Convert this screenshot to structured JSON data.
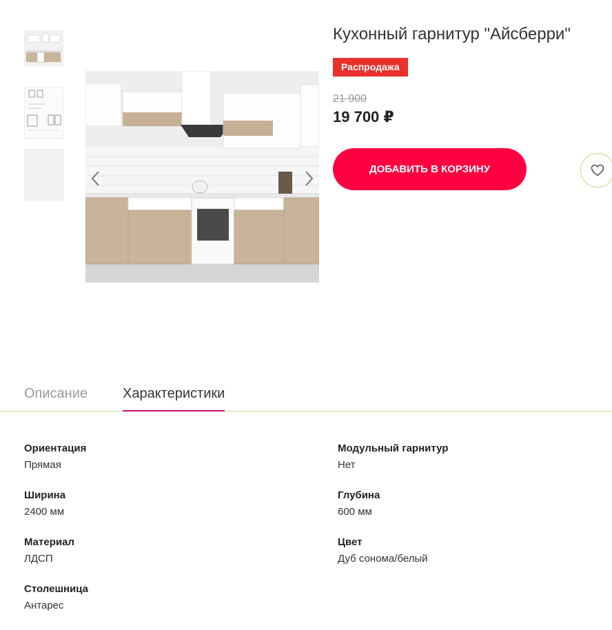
{
  "product": {
    "title": "Кухонный гарнитур \"Айсберри\"",
    "badge": "Распродажа",
    "old_price": "21 900",
    "price": "19 700 ₽",
    "cart_button": "ДОБАВИТЬ В КОРЗИНУ"
  },
  "gallery": {
    "thumbnails": [
      "kitchen-photo",
      "scheme-drawing",
      "texture-sample"
    ],
    "arrows": [
      "chevron-left-icon",
      "chevron-right-icon"
    ]
  },
  "icons": {
    "favorite": "heart-icon"
  },
  "tabs": {
    "description": "Описание",
    "specs": "Характеристики",
    "active": "Характеристики"
  },
  "specs": [
    {
      "key": "Ориентация",
      "value": "Прямая"
    },
    {
      "key": "Модульный гарнитур",
      "value": "Нет"
    },
    {
      "key": "Ширина",
      "value": "2400 мм"
    },
    {
      "key": "Глубина",
      "value": "600 мм"
    },
    {
      "key": "Материал",
      "value": "ЛДСП"
    },
    {
      "key": "Цвет",
      "value": "Дуб сонома/белый"
    },
    {
      "key": "Столешница",
      "value": "Антарес"
    }
  ],
  "colors": {
    "accent": "#ff0040",
    "sale": "#e9302c",
    "tab_underline": "#c8146e",
    "divider": "#c5dd90"
  }
}
